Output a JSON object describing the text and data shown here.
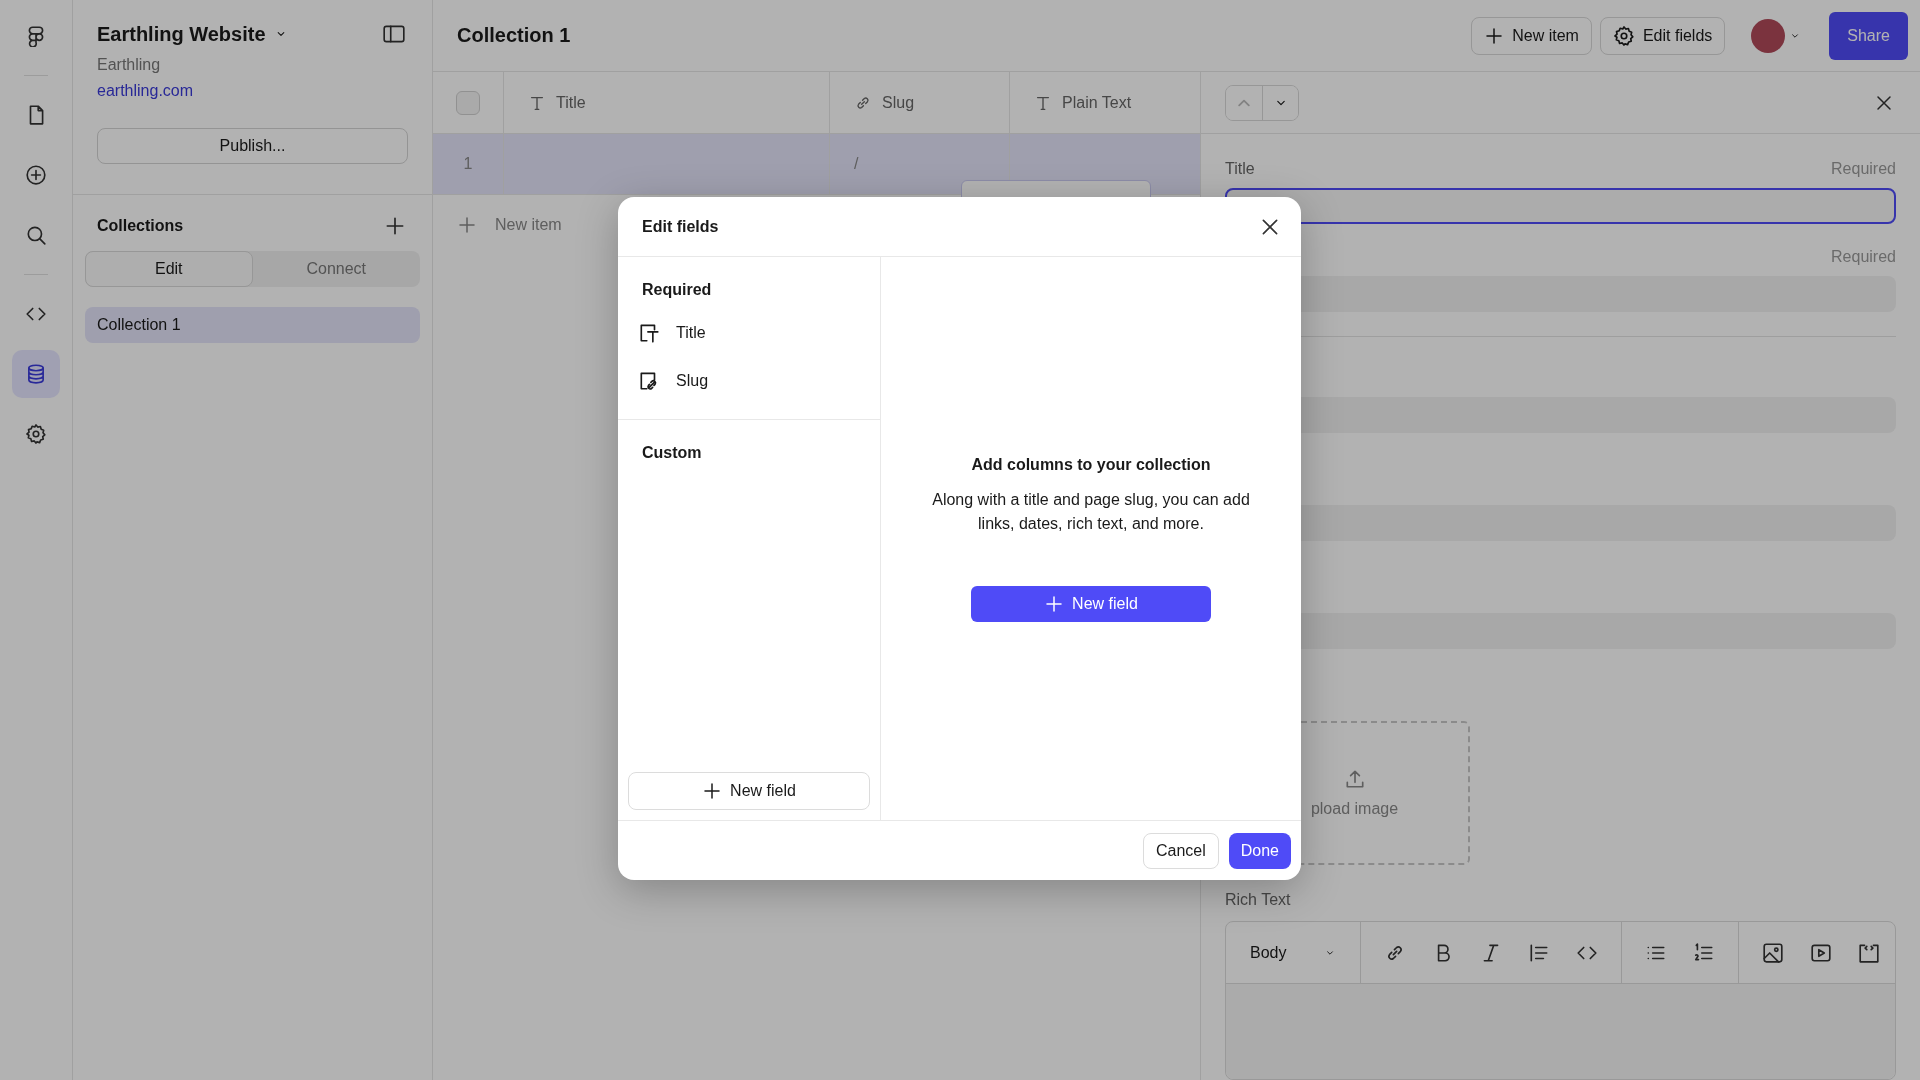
{
  "rail_items": [
    {
      "kind": "logo",
      "selected": false
    },
    {
      "kind": "pages",
      "selected": false
    },
    {
      "kind": "insert",
      "selected": false
    },
    {
      "kind": "search",
      "selected": false
    },
    {
      "kind": "code",
      "selected": false
    },
    {
      "kind": "cms",
      "selected": true
    },
    {
      "kind": "settings",
      "selected": false
    }
  ],
  "project": {
    "name": "Earthling Website",
    "team": "Earthling",
    "domain": "earthling.com",
    "publish": "Publish..."
  },
  "collections": {
    "heading": "Collections",
    "tabs": [
      {
        "label": "Edit",
        "selected": true
      },
      {
        "label": "Connect",
        "selected": false
      }
    ],
    "items": [
      {
        "label": "Collection 1",
        "selected": true
      }
    ]
  },
  "topbar": {
    "title": "Collection 1",
    "new_item": "New item",
    "edit_fields": "Edit fields",
    "share": "Share"
  },
  "table": {
    "select_all": {
      "checked": false
    },
    "columns": [
      {
        "label": "Title",
        "kind": "text"
      },
      {
        "label": "Slug",
        "kind": "link"
      },
      {
        "label": "Plain Text",
        "kind": "text"
      }
    ],
    "rows": [
      {
        "number": "1",
        "slug": "/",
        "selected": true
      }
    ],
    "new_item": "New item"
  },
  "detail": {
    "fields": [
      {
        "label": "Title",
        "note": "Required",
        "focused": true
      },
      {
        "note": "Required",
        "focused": false
      },
      {
        "focused": false
      },
      {
        "focused": false
      },
      {
        "focused": false
      }
    ],
    "upload": "pload image",
    "rich_text_label": "Rich Text",
    "text_style": "Body"
  },
  "modal": {
    "title": "Edit fields",
    "sections": [
      {
        "heading": "Required",
        "fields": [
          {
            "label": "Title",
            "kind": "title"
          },
          {
            "label": "Slug",
            "kind": "slug"
          }
        ]
      },
      {
        "heading": "Custom"
      }
    ],
    "side_button": "New field",
    "empty_title": "Add columns to your collection",
    "empty_text": "Along with a title and page slug, you can add links, dates, rich text, and more.",
    "primary_button": "New field",
    "cancel": "Cancel",
    "done": "Done"
  }
}
